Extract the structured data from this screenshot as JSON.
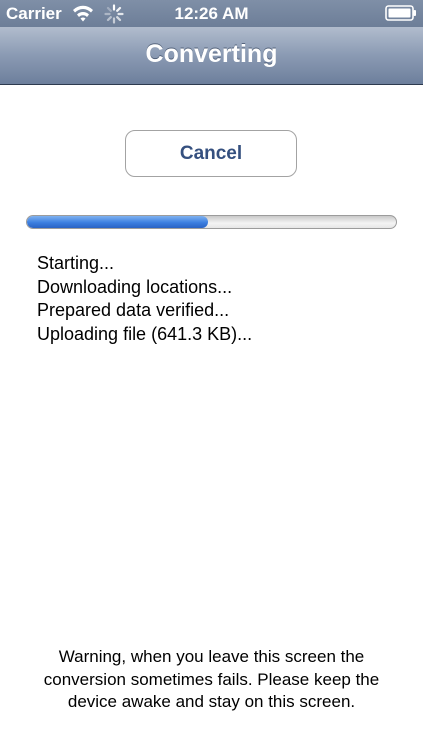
{
  "status_bar": {
    "carrier": "Carrier",
    "time": "12:26 AM",
    "wifi_icon": "wifi-icon",
    "activity_icon": "activity-spinner-icon",
    "battery_icon": "battery-icon"
  },
  "nav": {
    "title": "Converting"
  },
  "cancel_label": "Cancel",
  "progress": {
    "fraction": 0.49,
    "fill_color": "#3c7fe0"
  },
  "log": [
    "Starting...",
    "Downloading locations...",
    "Prepared data verified...",
    "Uploading file (641.3 KB)..."
  ],
  "warning": "Warning, when you leave this screen the conversion sometimes fails. Please keep the device awake and stay on this screen."
}
